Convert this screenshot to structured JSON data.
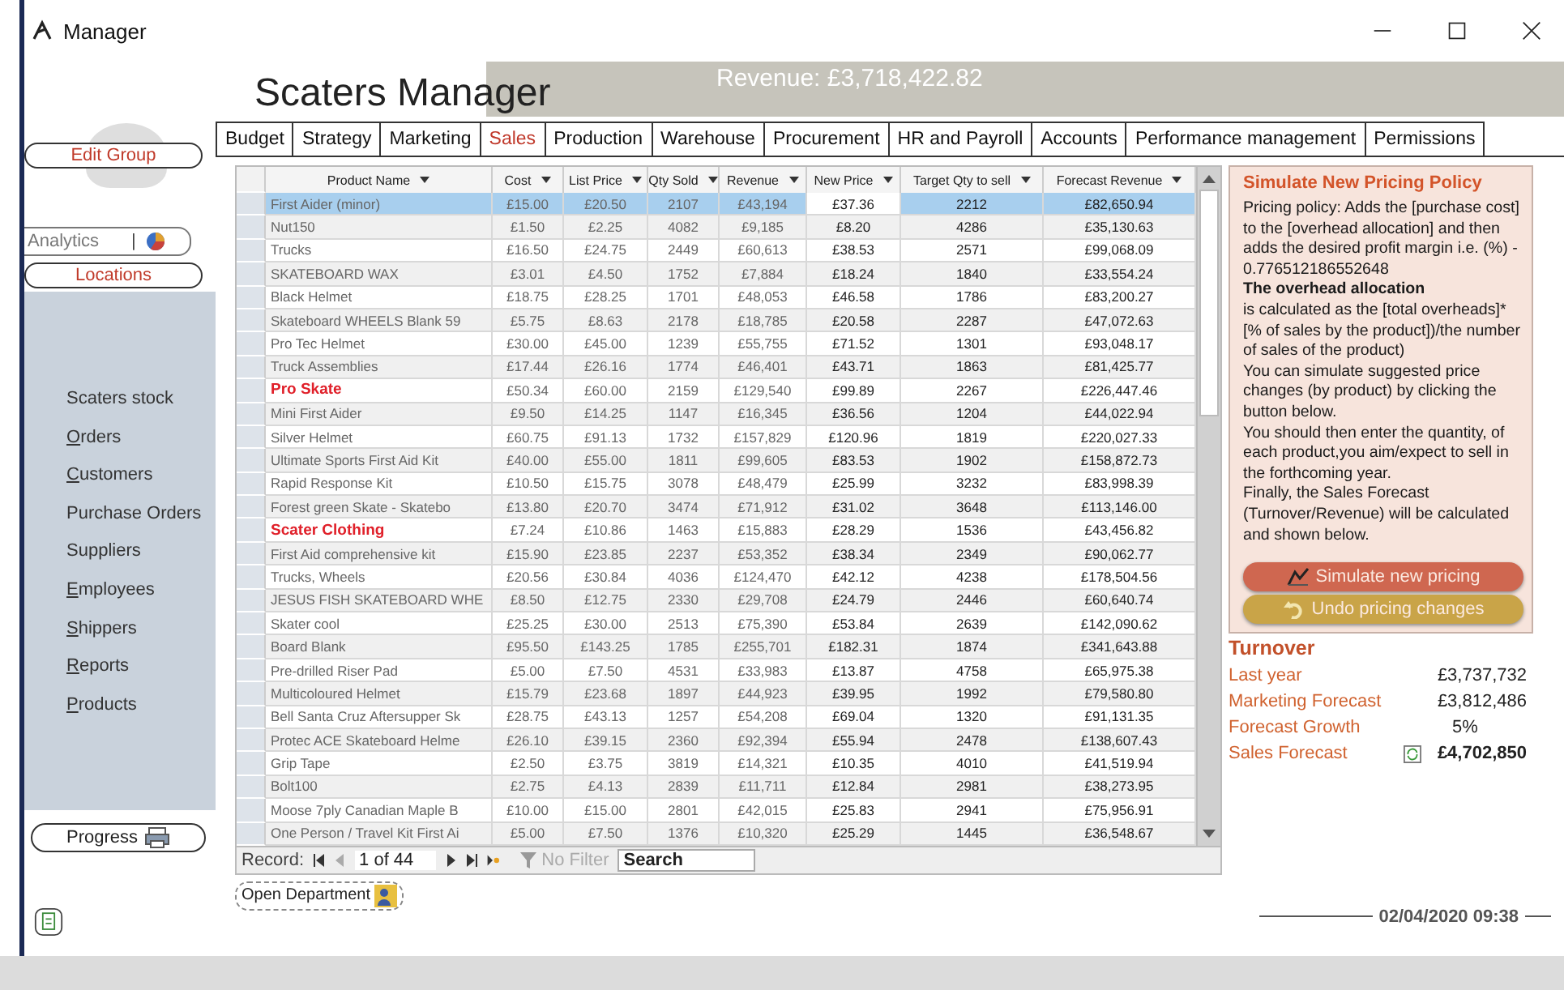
{
  "window": {
    "title": "Manager"
  },
  "header": {
    "title": "Scaters Manager",
    "revenue": "Revenue: £3,718,422.82"
  },
  "tabs": [
    {
      "label": "Budget",
      "selected": false
    },
    {
      "label": "Strategy",
      "selected": false
    },
    {
      "label": "Marketing",
      "selected": false
    },
    {
      "label": "Sales",
      "selected": true
    },
    {
      "label": "Production",
      "selected": false
    },
    {
      "label": "Warehouse",
      "selected": false
    },
    {
      "label": "Procurement",
      "selected": false
    },
    {
      "label": "HR and Payroll",
      "selected": false
    },
    {
      "label": "Accounts",
      "selected": false
    },
    {
      "label": "Performance management",
      "selected": false
    },
    {
      "label": "Permissions",
      "selected": false
    }
  ],
  "sidebar": {
    "edit_group": "Edit Group",
    "analytics": "Analytics",
    "analytics_separator": "|",
    "locations": "Locations",
    "items": [
      {
        "label": "Scaters stock",
        "underlined": false
      },
      {
        "label": "Orders",
        "underlined": true
      },
      {
        "label": "Customers",
        "underlined": true
      },
      {
        "label": "Purchase Orders",
        "underlined": false
      },
      {
        "label": "Suppliers",
        "underlined": false
      },
      {
        "label": "Employees",
        "underlined": true
      },
      {
        "label": "Shippers",
        "underlined": true
      },
      {
        "label": "Reports",
        "underlined": true
      },
      {
        "label": "Products",
        "underlined": true
      }
    ],
    "progress": "Progress"
  },
  "table": {
    "columns": [
      "Product Name",
      "Cost",
      "List Price",
      "Qty Sold",
      "Revenue",
      "New Price",
      "Target Qty to sell",
      "Forecast Revenue"
    ],
    "rows": [
      {
        "kind": "product",
        "selected": true,
        "cells": [
          "First Aider (minor)",
          "£15.00",
          "£20.50",
          "2107",
          "£43,194",
          "£37.36",
          "2212",
          "£82,650.94"
        ]
      },
      {
        "kind": "product",
        "selected": false,
        "cells": [
          "Nut150",
          "£1.50",
          "£2.25",
          "4082",
          "£9,185",
          "£8.20",
          "4286",
          "£35,130.63"
        ]
      },
      {
        "kind": "product",
        "selected": false,
        "cells": [
          "Trucks",
          "£16.50",
          "£24.75",
          "2449",
          "£60,613",
          "£38.53",
          "2571",
          "£99,068.09"
        ]
      },
      {
        "kind": "product",
        "selected": false,
        "cells": [
          "SKATEBOARD WAX",
          "£3.01",
          "£4.50",
          "1752",
          "£7,884",
          "£18.24",
          "1840",
          "£33,554.24"
        ]
      },
      {
        "kind": "product",
        "selected": false,
        "cells": [
          "Black Helmet",
          "£18.75",
          "£28.25",
          "1701",
          "£48,053",
          "£46.58",
          "1786",
          "£83,200.27"
        ]
      },
      {
        "kind": "product",
        "selected": false,
        "cells": [
          "Skateboard WHEELS Blank 59",
          "£5.75",
          "£8.63",
          "2178",
          "£18,785",
          "£20.58",
          "2287",
          "£47,072.63"
        ]
      },
      {
        "kind": "product",
        "selected": false,
        "cells": [
          "Pro Tec Helmet",
          "£30.00",
          "£45.00",
          "1239",
          "£55,755",
          "£71.52",
          "1301",
          "£93,048.17"
        ]
      },
      {
        "kind": "product",
        "selected": false,
        "cells": [
          "Truck Assemblies",
          "£17.44",
          "£26.16",
          "1774",
          "£46,401",
          "£43.71",
          "1863",
          "£81,425.77"
        ]
      },
      {
        "kind": "category",
        "selected": false,
        "cells": [
          "Pro Skate",
          "£50.34",
          "£60.00",
          "2159",
          "£129,540",
          "£99.89",
          "2267",
          "£226,447.46"
        ]
      },
      {
        "kind": "product",
        "selected": false,
        "cells": [
          "Mini First Aider",
          "£9.50",
          "£14.25",
          "1147",
          "£16,345",
          "£36.56",
          "1204",
          "£44,022.94"
        ]
      },
      {
        "kind": "product",
        "selected": false,
        "cells": [
          "Silver Helmet",
          "£60.75",
          "£91.13",
          "1732",
          "£157,829",
          "£120.96",
          "1819",
          "£220,027.33"
        ]
      },
      {
        "kind": "product",
        "selected": false,
        "cells": [
          "Ultimate Sports First Aid Kit",
          "£40.00",
          "£55.00",
          "1811",
          "£99,605",
          "£83.53",
          "1902",
          "£158,872.73"
        ]
      },
      {
        "kind": "product",
        "selected": false,
        "cells": [
          "Rapid Response Kit",
          "£10.50",
          "£15.75",
          "3078",
          "£48,479",
          "£25.99",
          "3232",
          "£83,998.39"
        ]
      },
      {
        "kind": "product",
        "selected": false,
        "cells": [
          "Forest green Skate - Skatebo",
          "£13.80",
          "£20.70",
          "3474",
          "£71,912",
          "£31.02",
          "3648",
          "£113,146.00"
        ]
      },
      {
        "kind": "category",
        "selected": false,
        "cells": [
          "Scater Clothing",
          "£7.24",
          "£10.86",
          "1463",
          "£15,883",
          "£28.29",
          "1536",
          "£43,456.82"
        ]
      },
      {
        "kind": "product",
        "selected": false,
        "cells": [
          "First Aid comprehensive kit",
          "£15.90",
          "£23.85",
          "2237",
          "£53,352",
          "£38.34",
          "2349",
          "£90,062.77"
        ]
      },
      {
        "kind": "product",
        "selected": false,
        "cells": [
          "Trucks, Wheels",
          "£20.56",
          "£30.84",
          "4036",
          "£124,470",
          "£42.12",
          "4238",
          "£178,504.56"
        ]
      },
      {
        "kind": "product",
        "selected": false,
        "cells": [
          "JESUS FISH SKATEBOARD WHE",
          "£8.50",
          "£12.75",
          "2330",
          "£29,708",
          "£24.79",
          "2446",
          "£60,640.74"
        ]
      },
      {
        "kind": "product",
        "selected": false,
        "cells": [
          "Skater cool",
          "£25.25",
          "£30.00",
          "2513",
          "£75,390",
          "£53.84",
          "2639",
          "£142,090.62"
        ]
      },
      {
        "kind": "product",
        "selected": false,
        "cells": [
          "Board Blank",
          "£95.50",
          "£143.25",
          "1785",
          "£255,701",
          "£182.31",
          "1874",
          "£341,643.88"
        ]
      },
      {
        "kind": "product",
        "selected": false,
        "cells": [
          "Pre-drilled Riser Pad",
          "£5.00",
          "£7.50",
          "4531",
          "£33,983",
          "£13.87",
          "4758",
          "£65,975.38"
        ]
      },
      {
        "kind": "product",
        "selected": false,
        "cells": [
          "Multicoloured Helmet",
          "£15.79",
          "£23.68",
          "1897",
          "£44,923",
          "£39.95",
          "1992",
          "£79,580.80"
        ]
      },
      {
        "kind": "product",
        "selected": false,
        "cells": [
          "Bell Santa Cruz Aftersupper Sk",
          "£28.75",
          "£43.13",
          "1257",
          "£54,208",
          "£69.04",
          "1320",
          "£91,131.35"
        ]
      },
      {
        "kind": "product",
        "selected": false,
        "cells": [
          "Protec ACE Skateboard Helme",
          "£26.10",
          "£39.15",
          "2360",
          "£92,394",
          "£55.94",
          "2478",
          "£138,607.43"
        ]
      },
      {
        "kind": "product",
        "selected": false,
        "cells": [
          "Grip Tape",
          "£2.50",
          "£3.75",
          "3819",
          "£14,321",
          "£10.35",
          "4010",
          "£41,519.94"
        ]
      },
      {
        "kind": "product",
        "selected": false,
        "cells": [
          "Bolt100",
          "£2.75",
          "£4.13",
          "2839",
          "£11,711",
          "£12.84",
          "2981",
          "£38,273.95"
        ]
      },
      {
        "kind": "product",
        "selected": false,
        "cells": [
          "Moose 7ply Canadian Maple B",
          "£10.00",
          "£15.00",
          "2801",
          "£42,015",
          "£25.83",
          "2941",
          "£75,956.91"
        ]
      },
      {
        "kind": "product",
        "selected": false,
        "cells": [
          "One Person / Travel Kit First Ai",
          "£5.00",
          "£7.50",
          "1376",
          "£10,320",
          "£25.29",
          "1445",
          "£36,548.67"
        ]
      }
    ]
  },
  "navigator": {
    "label": "Record:",
    "position": "1 of 44",
    "filter": "No Filter",
    "filter_disabled": true,
    "search": "Search"
  },
  "pricing_panel": {
    "title": "Simulate New Pricing Policy",
    "text": "Pricing policy: Adds the [purchase cost] to the [overhead allocation] and then adds the desired profit margin i.e. (%) - 0.776512186552648\n **The overhead allocation**\nis calculated as the [total overheads]* [% of sales by the product])/the number of sales of the product)\n You can simulate suggested price changes (by product) by clicking the button below.\nYou should then enter the quantity, of each product,you aim/expect to sell in the forthcoming year.\nFinally, the Sales Forecast (Turnover/Revenue) will be calculated and shown below.",
    "simulate_button": "Simulate new pricing",
    "undo_button": "Undo pricing changes"
  },
  "turnover": {
    "title": "Turnover",
    "rows": [
      {
        "label": "Last year",
        "value": "£3,737,732",
        "kind": "plain"
      },
      {
        "label": "Marketing Forecast",
        "value": "£3,812,486",
        "kind": "plain"
      },
      {
        "label": "Forecast Growth",
        "value": "5%",
        "kind": "centered"
      },
      {
        "label": "Sales Forecast",
        "value": "£4,702,850",
        "kind": "total"
      }
    ]
  },
  "footer": {
    "open_department": "Open Department",
    "datetime": "02/04/2020 09:38"
  }
}
